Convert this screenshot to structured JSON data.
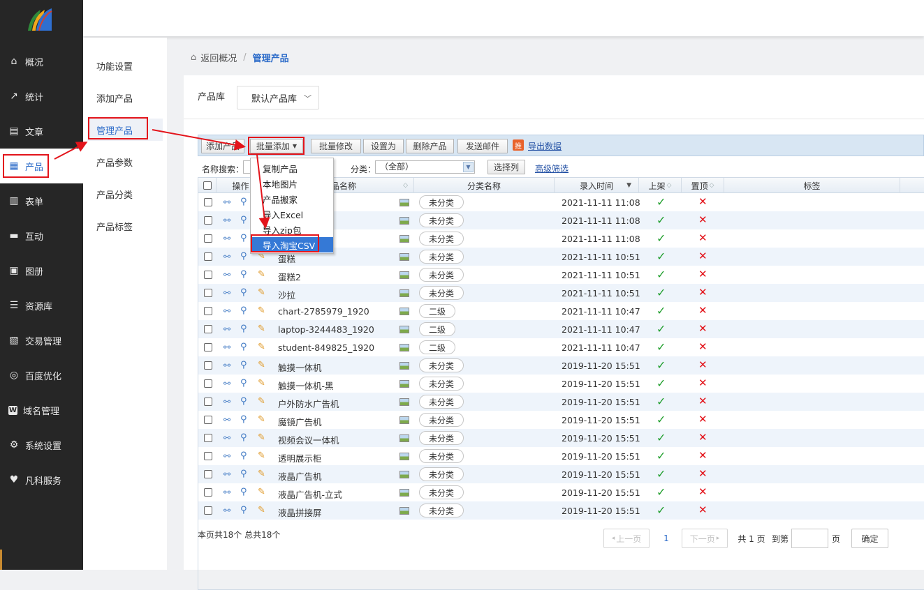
{
  "sidebar": {
    "items": [
      {
        "label": "概况",
        "icon": "home-icon"
      },
      {
        "label": "统计",
        "icon": "chart-icon"
      },
      {
        "label": "文章",
        "icon": "article-icon"
      },
      {
        "label": "产品",
        "icon": "grid-icon"
      },
      {
        "label": "表单",
        "icon": "form-icon"
      },
      {
        "label": "互动",
        "icon": "chat-icon"
      },
      {
        "label": "图册",
        "icon": "album-icon"
      },
      {
        "label": "资源库",
        "icon": "database-icon"
      },
      {
        "label": "交易管理",
        "icon": "clipboard-icon"
      },
      {
        "label": "百度优化",
        "icon": "target-icon"
      },
      {
        "label": "域名管理",
        "icon": "w-icon"
      },
      {
        "label": "系统设置",
        "icon": "gear-icon"
      },
      {
        "label": "凡科服务",
        "icon": "heart-icon"
      }
    ]
  },
  "subnav": {
    "items": [
      "功能设置",
      "添加产品",
      "管理产品",
      "产品参数",
      "产品分类",
      "产品标签"
    ]
  },
  "breadcrumb": {
    "back": "返回概况",
    "separator": "/",
    "current": "管理产品"
  },
  "library": {
    "label": "产品库",
    "selected": "默认产品库"
  },
  "toolbar": {
    "add": "添加产品",
    "batch_add": "批量添加",
    "batch_edit": "批量修改",
    "set_as": "设置为",
    "delete": "删除产品",
    "send_mail": "发送邮件",
    "export_badge": "推",
    "export": "导出数据"
  },
  "filter": {
    "name_label": "名称搜索：",
    "cat_label": "分类：",
    "cat_value": "（全部）",
    "choose_cols": "选择列",
    "advanced": "高级筛选"
  },
  "dropdown": {
    "items": [
      "复制产品",
      "本地图片",
      "产品搬家",
      "导入Excel",
      "导入zip包",
      "导入淘宝CSV"
    ]
  },
  "table": {
    "headers": {
      "ops": "操作",
      "name": "产品名称",
      "category": "分类名称",
      "time": "录入时间",
      "on_shelf": "上架",
      "pinned": "置顶",
      "tags": "标签"
    },
    "rows": [
      {
        "name": "",
        "category": "未分类",
        "time": "2021-11-11 11:08"
      },
      {
        "name": "",
        "category": "未分类",
        "time": "2021-11-11 11:08"
      },
      {
        "name": "",
        "category": "未分类",
        "time": "2021-11-11 11:08"
      },
      {
        "name": "蛋糕",
        "category": "未分类",
        "time": "2021-11-11 10:51"
      },
      {
        "name": "蛋糕2",
        "category": "未分类",
        "time": "2021-11-11 10:51"
      },
      {
        "name": "沙拉",
        "category": "未分类",
        "time": "2021-11-11 10:51"
      },
      {
        "name": "chart-2785979_1920",
        "category": "二级",
        "time": "2021-11-11 10:47"
      },
      {
        "name": "laptop-3244483_1920",
        "category": "二级",
        "time": "2021-11-11 10:47"
      },
      {
        "name": "student-849825_1920",
        "category": "二级",
        "time": "2021-11-11 10:47"
      },
      {
        "name": "触摸一体机",
        "category": "未分类",
        "time": "2019-11-20 15:51"
      },
      {
        "name": "触摸一体机-黑",
        "category": "未分类",
        "time": "2019-11-20 15:51"
      },
      {
        "name": "户外防水广告机",
        "category": "未分类",
        "time": "2019-11-20 15:51"
      },
      {
        "name": "魔镜广告机",
        "category": "未分类",
        "time": "2019-11-20 15:51"
      },
      {
        "name": "视频会议一体机",
        "category": "未分类",
        "time": "2019-11-20 15:51"
      },
      {
        "name": "透明展示柜",
        "category": "未分类",
        "time": "2019-11-20 15:51"
      },
      {
        "name": "液晶广告机",
        "category": "未分类",
        "time": "2019-11-20 15:51"
      },
      {
        "name": "液晶广告机-立式",
        "category": "未分类",
        "time": "2019-11-20 15:51"
      },
      {
        "name": "液晶拼接屏",
        "category": "未分类",
        "time": "2019-11-20 15:51"
      }
    ]
  },
  "footer": {
    "summary": "本页共18个 总共18个",
    "prev": "上一页",
    "current_page": "1",
    "next": "下一页",
    "total_pages": "共 1 页",
    "goto": "到第",
    "page_unit": "页",
    "confirm": "确定"
  },
  "colors": {
    "accent": "#2d6cc9",
    "highlight_frame": "#e3141b",
    "sidebar_bg": "#262626"
  }
}
